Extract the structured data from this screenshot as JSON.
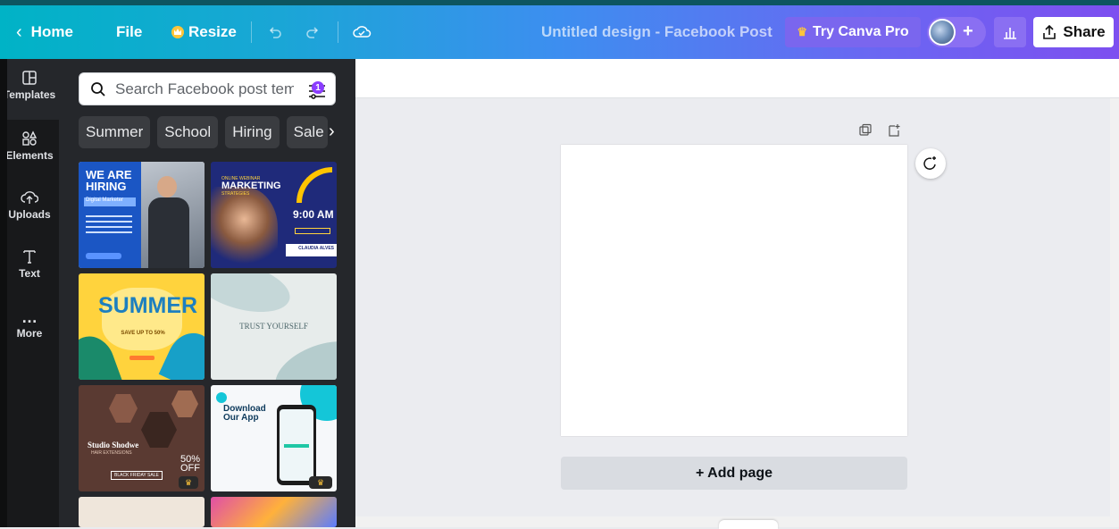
{
  "header": {
    "home_label": "Home",
    "file_label": "File",
    "resize_label": "Resize",
    "title": "Untitled design - Facebook Post",
    "try_pro_label": "Try Canva Pro",
    "share_label": "Share",
    "avatar_plus": "+"
  },
  "rail": {
    "items": [
      {
        "label": "Templates",
        "icon": "templates-icon"
      },
      {
        "label": "Elements",
        "icon": "elements-icon"
      },
      {
        "label": "Uploads",
        "icon": "uploads-icon"
      },
      {
        "label": "Text",
        "icon": "text-icon"
      },
      {
        "label": "More",
        "icon": "more-icon"
      }
    ]
  },
  "panel": {
    "search_placeholder": "Search Facebook post tem",
    "filter_badge": "1",
    "chips": [
      "Summer",
      "School",
      "Hiring",
      "Sale"
    ],
    "templates": [
      {
        "title": "WE ARE HIRING",
        "subtitle": "Digital Marketer"
      },
      {
        "title": "MARKETING",
        "kicker": "ONLINE WEBINAR",
        "sub": "STRATEGIES",
        "time": "9:00 AM",
        "name": "CLAUDIA ALVES"
      },
      {
        "title": "SUMMER",
        "sub": "SAVE UP TO 50%"
      },
      {
        "title": "TRUST YOURSELF"
      },
      {
        "title": "Studio Shodwe",
        "sub": "HAIR EXTENSIONS",
        "promo": "50% OFF",
        "tag": "BLACK FRIDAY SALE"
      },
      {
        "title": "Download Our App"
      }
    ]
  },
  "canvas": {
    "add_page_label": "+ Add page"
  },
  "colors": {
    "gradient_start": "#00b3c6",
    "gradient_end": "#7d4ff0",
    "accent": "#8b3dff",
    "crown": "#ffc53a"
  }
}
